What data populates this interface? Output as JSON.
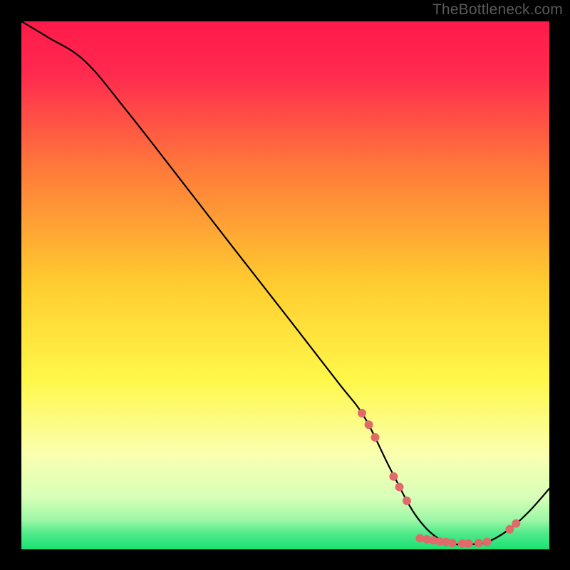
{
  "watermark": "TheBottleneck.com",
  "chart_data": {
    "type": "line",
    "title": "",
    "xlabel": "",
    "ylabel": "",
    "xlim": [
      0,
      100
    ],
    "ylim": [
      0,
      100
    ],
    "grid": false,
    "legend": false,
    "background_gradient": {
      "top": "#ff1a4a",
      "mid_upper": "#ffdb2e",
      "mid_lower": "#faffb0",
      "bottom": "#19e274"
    },
    "curve": {
      "description": "Bottleneck curve: high on the left, descending to a flat minimum valley around x≈70-88, then rising again on the right",
      "x": [
        0,
        5,
        12,
        20,
        30,
        40,
        50,
        60,
        65,
        70,
        75,
        80,
        85,
        88,
        92,
        96,
        100
      ],
      "y": [
        100,
        97,
        92.5,
        83,
        70.2,
        57.3,
        44.5,
        31.6,
        25,
        15,
        6,
        1.5,
        1,
        1.3,
        3.5,
        7,
        11.5
      ]
    },
    "markers": {
      "color": "#e06a6a",
      "radius_px": 6,
      "points": [
        {
          "x": 64.5,
          "y": 25.8
        },
        {
          "x": 65.8,
          "y": 23.6
        },
        {
          "x": 67.0,
          "y": 21.2
        },
        {
          "x": 70.5,
          "y": 13.8
        },
        {
          "x": 71.6,
          "y": 11.8
        },
        {
          "x": 73.0,
          "y": 9.2
        },
        {
          "x": 75.5,
          "y": 2.1
        },
        {
          "x": 76.8,
          "y": 1.9
        },
        {
          "x": 78.0,
          "y": 1.7
        },
        {
          "x": 79.2,
          "y": 1.5
        },
        {
          "x": 80.4,
          "y": 1.4
        },
        {
          "x": 81.6,
          "y": 1.2
        },
        {
          "x": 83.5,
          "y": 1.1
        },
        {
          "x": 84.7,
          "y": 1.1
        },
        {
          "x": 86.6,
          "y": 1.2
        },
        {
          "x": 88.2,
          "y": 1.4
        },
        {
          "x": 92.5,
          "y": 3.8
        },
        {
          "x": 93.7,
          "y": 4.9
        }
      ]
    }
  }
}
